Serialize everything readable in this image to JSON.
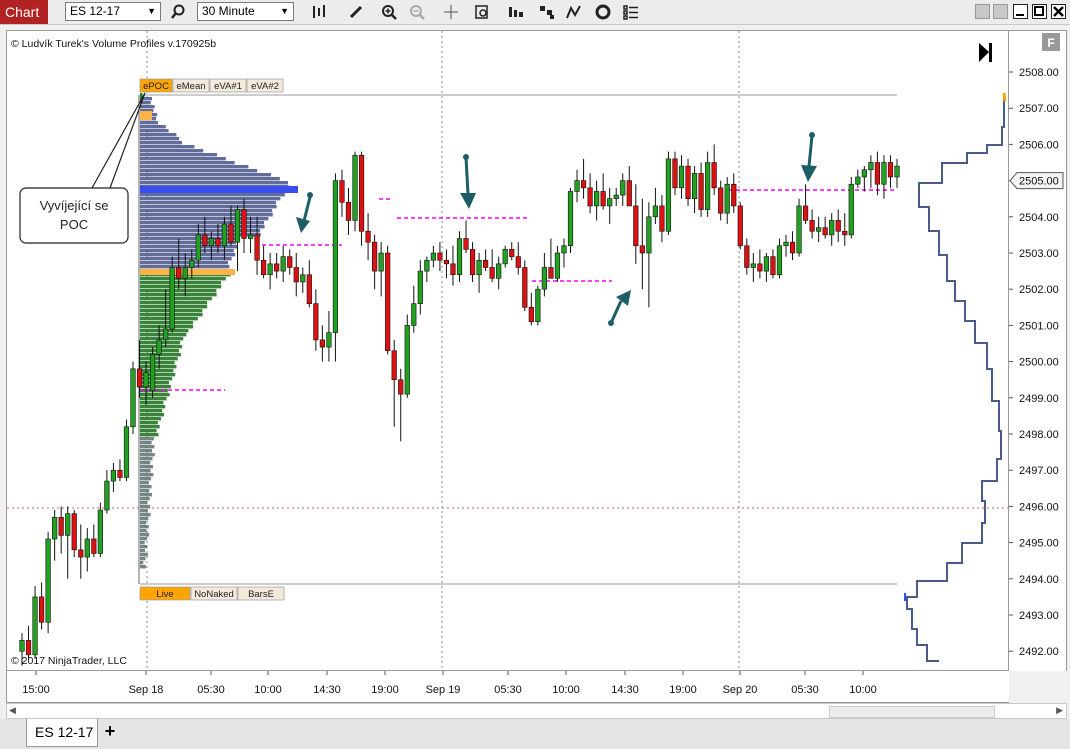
{
  "window": {
    "title": "Chart"
  },
  "toolbar": {
    "instrument": "ES 12-17",
    "interval": "30 Minute"
  },
  "indicator_label": "© Ludvík Turek's Volume Profiles v.170925b",
  "copyright": "© 2017 NinjaTrader, LLC",
  "profile_buttons_top": [
    "ePOC",
    "eMean",
    "eVA#1",
    "eVA#2"
  ],
  "profile_buttons_bottom": [
    "Live",
    "NoNaked",
    "BarsE"
  ],
  "annotation": {
    "line1": "Vyvíjející se",
    "line2": "POC"
  },
  "price_axis": {
    "labels": [
      "2508.00",
      "2507.00",
      "2506.00",
      "2505.00",
      "2504.00",
      "2503.00",
      "2502.00",
      "2501.00",
      "2500.00",
      "2499.00",
      "2498.00",
      "2497.00",
      "2496.00",
      "2495.00",
      "2494.00",
      "2493.00",
      "2492.00"
    ],
    "current_price": "2505.00"
  },
  "time_axis": {
    "labels": [
      "15:00",
      "Sep 18",
      "05:30",
      "10:00",
      "14:30",
      "19:00",
      "Sep 19",
      "05:30",
      "10:00",
      "14:30",
      "19:00",
      "Sep 20",
      "05:30",
      "10:00"
    ]
  },
  "tabs": [
    {
      "label": "ES 12-17"
    }
  ],
  "add_tab": "+",
  "f_button": "F",
  "colors": {
    "up": "#22a022",
    "down": "#dd1111",
    "poc": "#ff00ff",
    "profile_va": "#5a6496",
    "profile_green": "#2e7d2e",
    "profile_gray": "#6e7e7e",
    "poc_bar": "#3a4ef0",
    "title_bg": "#b22222"
  }
}
